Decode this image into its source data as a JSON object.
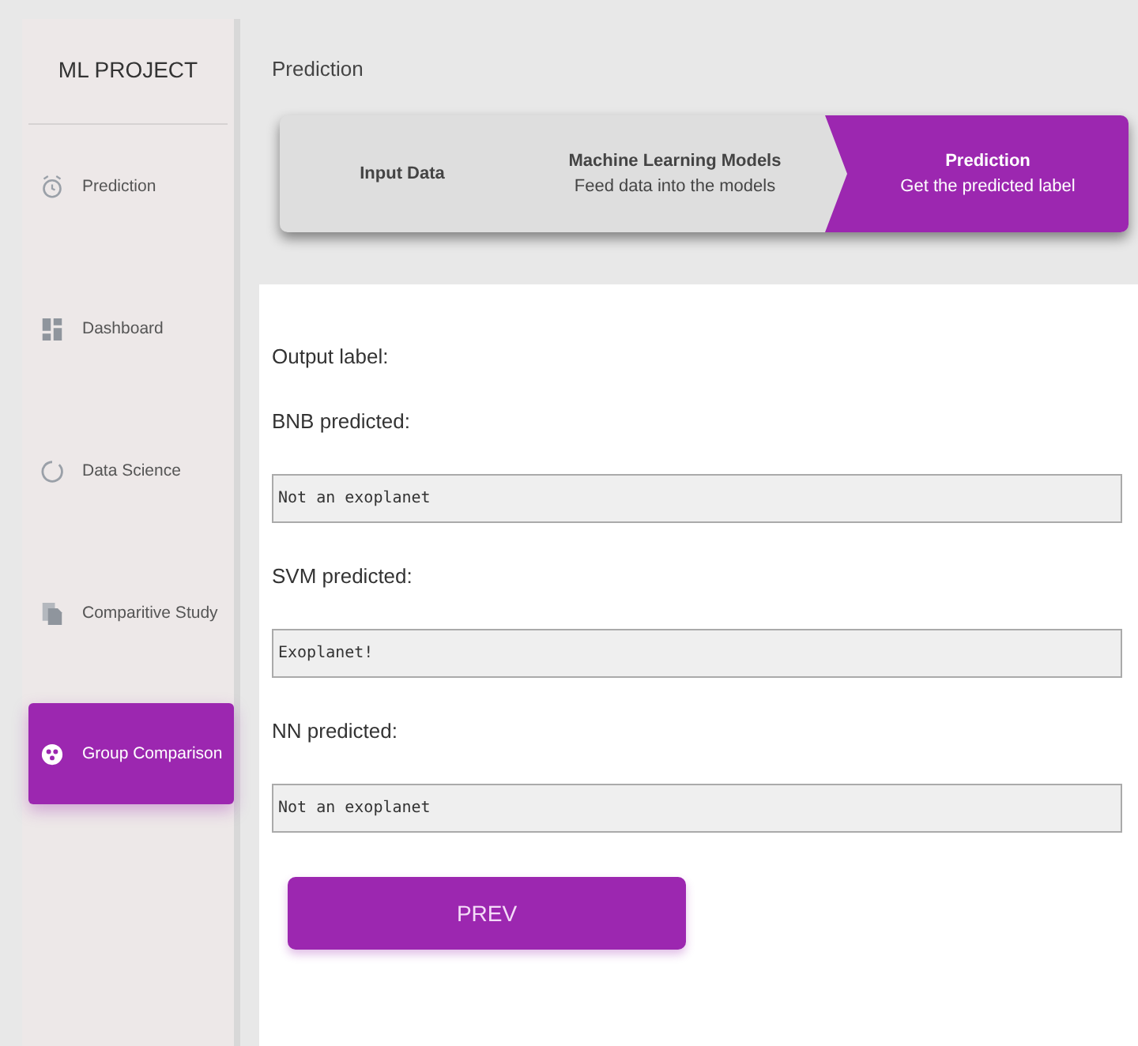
{
  "sidebar": {
    "title": "ML PROJECT",
    "items": [
      {
        "label": "Prediction",
        "kind": "alarm",
        "selected": false
      },
      {
        "label": "Dashboard",
        "kind": "dashboard",
        "selected": false
      },
      {
        "label": "Data Science",
        "kind": "ring",
        "selected": false
      },
      {
        "label": "Comparitive Study",
        "kind": "files",
        "selected": false
      },
      {
        "label": "Group Comparison",
        "kind": "group",
        "selected": true
      }
    ]
  },
  "page_title": "Prediction",
  "steps": [
    {
      "title": "Input Data",
      "selected": false
    },
    {
      "title": "Machine Learning Models",
      "subtitle": "Feed data into the models",
      "selected": false
    },
    {
      "title": "Prediction",
      "subtitle": "Get the predicted label",
      "selected": true
    }
  ],
  "output_label": "Output label:",
  "results": [
    {
      "label": "BNB predicted:",
      "value": "Not an exoplanet"
    },
    {
      "label": "SVM predicted:",
      "value": "Exoplanet!"
    },
    {
      "label": "NN predicted:",
      "value": "Not an exoplanet"
    }
  ],
  "prev_button": "PREV"
}
